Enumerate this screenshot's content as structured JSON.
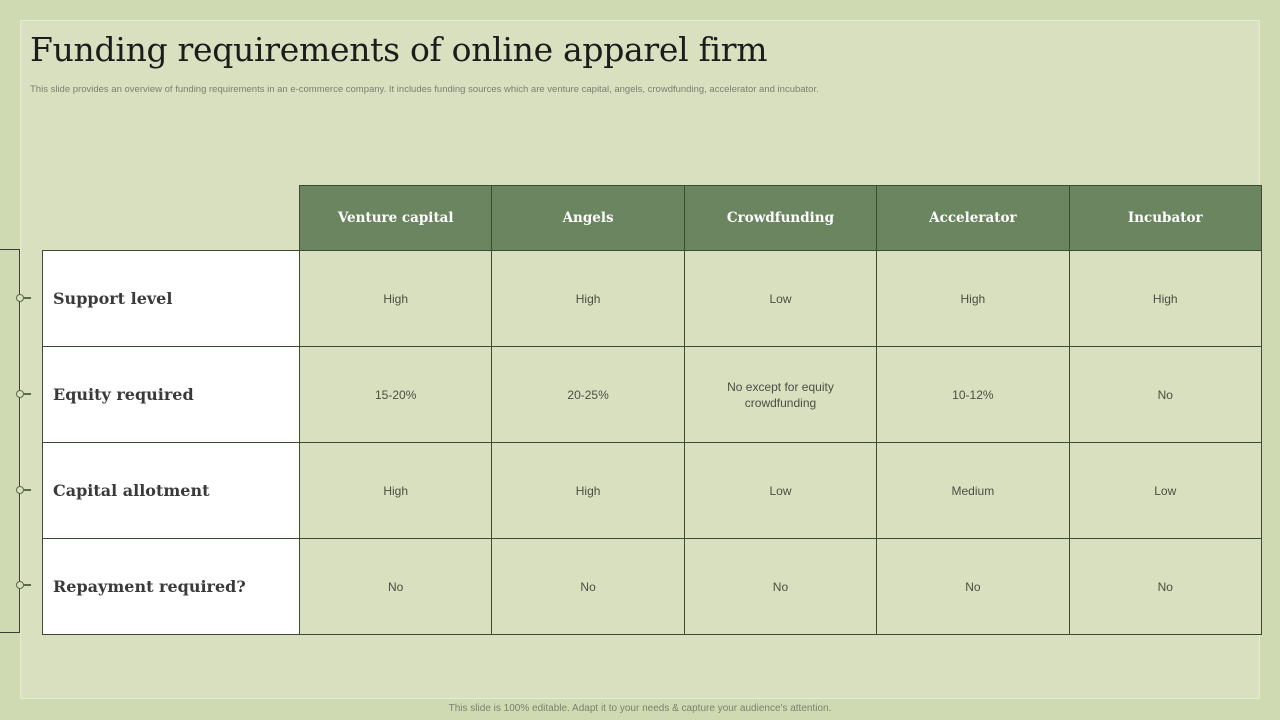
{
  "slide": {
    "title": "Funding requirements of online apparel firm",
    "subtitle": "This slide provides an overview of funding requirements in an e-commerce company. It includes funding sources which are venture capital, angels, crowdfunding, accelerator and incubator.",
    "footer": "This slide is 100% editable. Adapt it to your needs & capture your audience's attention."
  },
  "table": {
    "headers": [
      "Venture capital",
      "Angels",
      "Crowdfunding",
      "Accelerator",
      "Incubator"
    ],
    "rows": [
      {
        "label": "Support level",
        "cells": [
          "High",
          "High",
          "Low",
          "High",
          "High"
        ]
      },
      {
        "label": "Equity required",
        "cells": [
          "15-20%",
          "20-25%",
          "No except for equity crowdfunding",
          "10-12%",
          "No"
        ]
      },
      {
        "label": "Capital allotment",
        "cells": [
          "High",
          "High",
          "Low",
          "Medium",
          "Low"
        ]
      },
      {
        "label": "Repayment required?",
        "cells": [
          "No",
          "No",
          "No",
          "No",
          "No"
        ]
      }
    ]
  },
  "colors": {
    "header_bg": "#6b8561",
    "slide_bg": "#d9e0bf",
    "page_bg": "#d0dab2"
  }
}
